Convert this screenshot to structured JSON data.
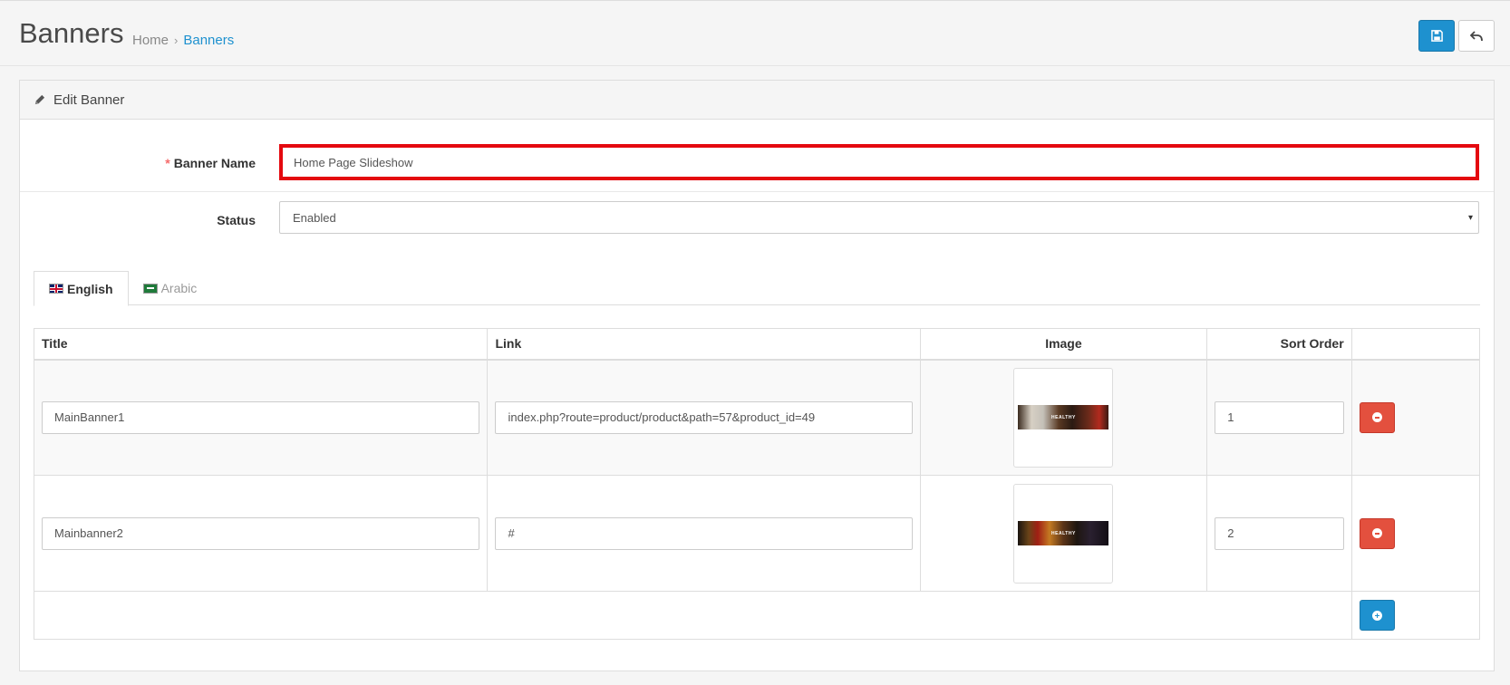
{
  "header": {
    "title": "Banners",
    "breadcrumb": {
      "home": "Home",
      "separator": "›",
      "current": "Banners"
    },
    "save_icon": "floppy-disk-icon",
    "back_icon": "reply-arrow-icon",
    "accent_color": "#1e91cf"
  },
  "panel": {
    "heading_icon": "pencil-icon",
    "heading": "Edit Banner"
  },
  "form": {
    "banner_name": {
      "required_mark": "*",
      "label": "Banner Name",
      "value": "Home Page Slideshow"
    },
    "status": {
      "label": "Status",
      "value": "Enabled",
      "caret": "▾"
    }
  },
  "tabs": [
    {
      "label": "English",
      "flag": "uk-flag-icon",
      "active": true
    },
    {
      "label": "Arabic",
      "flag": "arabic-flag-icon",
      "active": false
    }
  ],
  "table": {
    "headers": {
      "title": "Title",
      "link": "Link",
      "image": "Image",
      "sort_order": "Sort Order"
    },
    "rows": [
      {
        "title": "MainBanner1",
        "link": "index.php?route=product/product&path=57&product_id=49",
        "image_caption": "HEALTHY",
        "sort_order": "1"
      },
      {
        "title": "Mainbanner2",
        "link": "#",
        "image_caption": "HEALTHY",
        "sort_order": "2"
      }
    ],
    "remove_icon": "minus-circle-icon",
    "add_icon": "plus-circle-icon",
    "remove_color": "#e3503e"
  }
}
